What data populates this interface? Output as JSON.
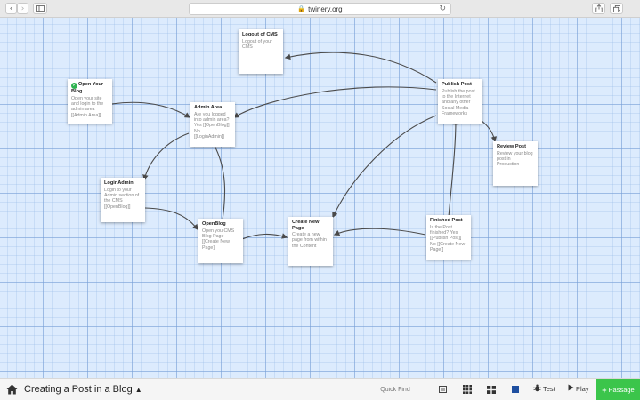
{
  "browser": {
    "url": "twinery.org",
    "lock_icon": "lock-icon"
  },
  "story": {
    "title": "Creating a Post in a Blog",
    "title_arrow": "▲"
  },
  "passages": {
    "logout": {
      "title": "Logout of CMS",
      "excerpt": "Logout of your CMS"
    },
    "open_blog_start": {
      "title": "Open Your Blog",
      "excerpt": "Open your site and login to the admin area [[Admin Area]]",
      "start_icon": "check-circle-icon"
    },
    "admin_area": {
      "title": "Admin Area",
      "excerpt": "Are you logged into admin area? Yes [[OpenBlog]] No [[LoginAdmin]]"
    },
    "login_admin": {
      "title": "LoginAdmin",
      "excerpt": "Login to your Admin section of the CMS [[OpenBlog]]"
    },
    "open_blog": {
      "title": "OpenBlog",
      "excerpt": "Open you CMS Blog Page [[Create New Page]]"
    },
    "create_new_page": {
      "title": "Create New Page",
      "excerpt": "Create a new page from within the Content"
    },
    "publish_post": {
      "title": "Publish Post",
      "excerpt": "Publish the post to the Internet and any other Social Media Frameworks"
    },
    "review_post": {
      "title": "Review Post",
      "excerpt": "Review your blog post in Production"
    },
    "finished_post": {
      "title": "Finished Post",
      "excerpt": "Is the Post finished? Yes [[Publish Post]] No [[Create New Page]]"
    }
  },
  "toolbar": {
    "quick_find_placeholder": "Quick Find",
    "test_label": "Test",
    "play_label": "Play",
    "add_passage_label": "Passage",
    "accent_color": "#3bc54b",
    "highlight_color": "#1f4fa0"
  }
}
